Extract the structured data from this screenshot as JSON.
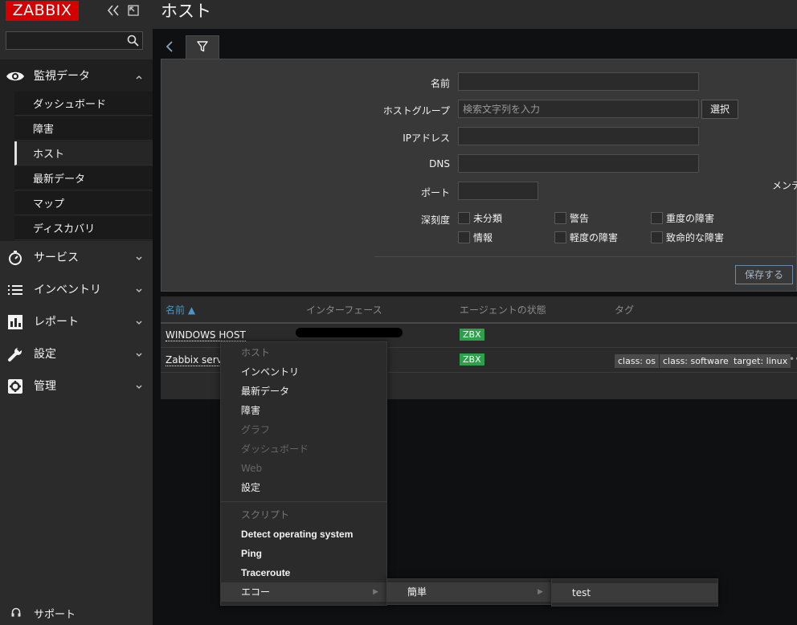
{
  "sidebar": {
    "logo": "ZABBIX",
    "search_value": "",
    "menus": [
      {
        "label": "監視データ",
        "icon": "eye-icon"
      },
      {
        "label": "サービス",
        "icon": "stopwatch-icon"
      },
      {
        "label": "インベントリ",
        "icon": "list-icon"
      },
      {
        "label": "レポート",
        "icon": "bar-chart-icon"
      },
      {
        "label": "設定",
        "icon": "wrench-icon"
      },
      {
        "label": "管理",
        "icon": "gear-icon"
      }
    ],
    "submenu": [
      "ダッシュボード",
      "障害",
      "ホスト",
      "最新データ",
      "マップ",
      "ディスカバリ"
    ],
    "support": "サポート"
  },
  "header": {
    "title": "ホスト"
  },
  "filter": {
    "name_label": "名前",
    "hostgroup_label": "ホストグループ",
    "hostgroup_placeholder": "検索文字列を入力",
    "select_button": "選択",
    "ip_label": "IPアドレス",
    "dns_label": "DNS",
    "port_label": "ポート",
    "maintenance_label": "メンテ",
    "severity_label": "深刻度",
    "severities": [
      "未分類",
      "警告",
      "重度の障害",
      "情報",
      "軽度の障害",
      "致命的な障害"
    ],
    "save_button": "保存する"
  },
  "table": {
    "columns": [
      "名前 ▲",
      "インターフェース",
      "エージェントの状態",
      "タグ"
    ],
    "rows": [
      {
        "name": "WINDOWS HOST",
        "agent": "ZBX",
        "tags": []
      },
      {
        "name": "Zabbix server",
        "agent": "ZBX",
        "tags": [
          "class: os",
          "class: software",
          "target: linux"
        ]
      }
    ]
  },
  "context_menu": {
    "header": "ホスト",
    "items": [
      "インベントリ",
      "最新データ",
      "障害",
      "グラフ",
      "ダッシュボード",
      "Web",
      "設定"
    ],
    "scripts_header": "スクリプト",
    "scripts": [
      "Detect operating system",
      "Ping",
      "Traceroute",
      "エコー"
    ],
    "submenu1": "簡単",
    "submenu2": "test"
  },
  "colors": {
    "accent": "#4796c4",
    "brand": "#d40000",
    "ok": "#2ca04a"
  }
}
